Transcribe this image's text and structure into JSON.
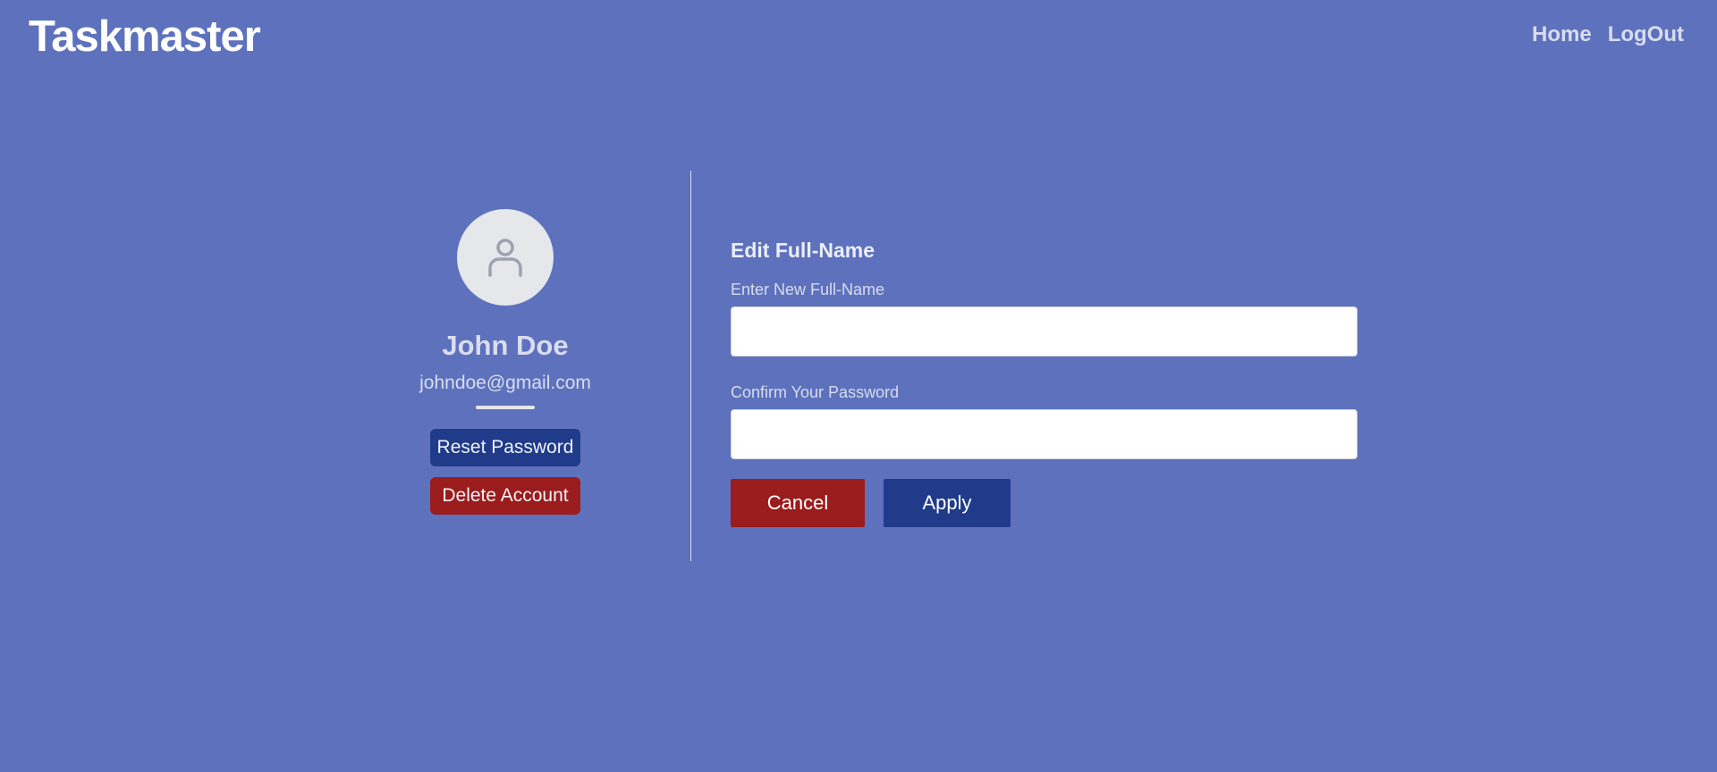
{
  "header": {
    "brand": "Taskmaster",
    "nav": [
      {
        "label": "Home"
      },
      {
        "label": "LogOut"
      }
    ]
  },
  "profile": {
    "avatar_icon": "user-icon",
    "name": "John Doe",
    "email": "johndoe@gmail.com",
    "reset_password_label": "Reset Password",
    "delete_account_label": "Delete Account"
  },
  "edit_form": {
    "title": "Edit Full-Name",
    "fullname": {
      "label": "Enter New Full-Name",
      "value": "",
      "placeholder": ""
    },
    "password": {
      "label": "Confirm Your Password",
      "value": "",
      "placeholder": ""
    },
    "cancel_label": "Cancel",
    "apply_label": "Apply"
  },
  "colors": {
    "background": "#5d71bd",
    "primary_button": "#1f3b8a",
    "danger_button": "#9b1c1c",
    "avatar_bg": "#e5e7eb"
  }
}
